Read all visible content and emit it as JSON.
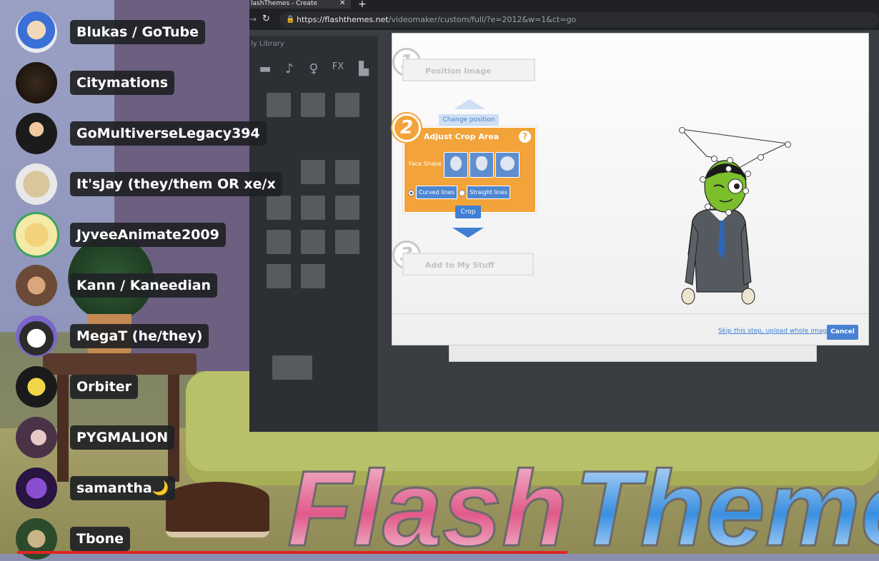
{
  "members": [
    {
      "name": "Blukas / GoTube",
      "avatar_icon": "blue-hair-avatar-icon"
    },
    {
      "name": "Citymations",
      "avatar_icon": "dark-creature-avatar-icon"
    },
    {
      "name": "GoMultiverseLegacy394",
      "avatar_icon": "boy-avatar-icon"
    },
    {
      "name": "It'sJay (they/them OR xe/x",
      "avatar_icon": "cat-avatar-icon"
    },
    {
      "name": "JyveeAnimate2009",
      "avatar_icon": "crown-avatar-icon"
    },
    {
      "name": "Kann / Kaneedian",
      "avatar_icon": "photo-avatar-icon"
    },
    {
      "name": "MegaT (he/they)",
      "avatar_icon": "cat-avatar-icon"
    },
    {
      "name": "Orbiter",
      "avatar_icon": "robot-avatar-icon"
    },
    {
      "name": "PYGMALION",
      "avatar_icon": "figure-avatar-icon"
    },
    {
      "name": "samantha🌙",
      "avatar_icon": "purple-avatar-icon"
    },
    {
      "name": "Tbone",
      "avatar_icon": "hat-avatar-icon"
    }
  ],
  "browser": {
    "tab_title": "lashThemes - Create",
    "url_host": "https://flashthemes.net",
    "url_path": "/videomaker/custom/full/?e=2012&w=1&ct=go"
  },
  "studio": {
    "library_tab": "ly Library"
  },
  "wizard": {
    "step1_number": "1",
    "step1_label": "Position Image",
    "change_position": "Change position",
    "step2_number": "2",
    "step2_title": "Adjust Crop Area",
    "help": "?",
    "face_shape_label": "Face Shape",
    "option_curved": "Curved lines",
    "option_straight": "Straight lines",
    "crop_button": "Crop",
    "step3_number": "3",
    "step3_label": "Add to My Stuff",
    "skip_link": "Skip this step, upload whole image",
    "cancel_button": "Cancel"
  },
  "watermark": {
    "text": "FlashTheme"
  },
  "colors": {
    "accent_orange": "#f2a33a",
    "accent_blue": "#3f7fd6",
    "discord_chip": "#202225",
    "progress_red": "#e02424"
  }
}
